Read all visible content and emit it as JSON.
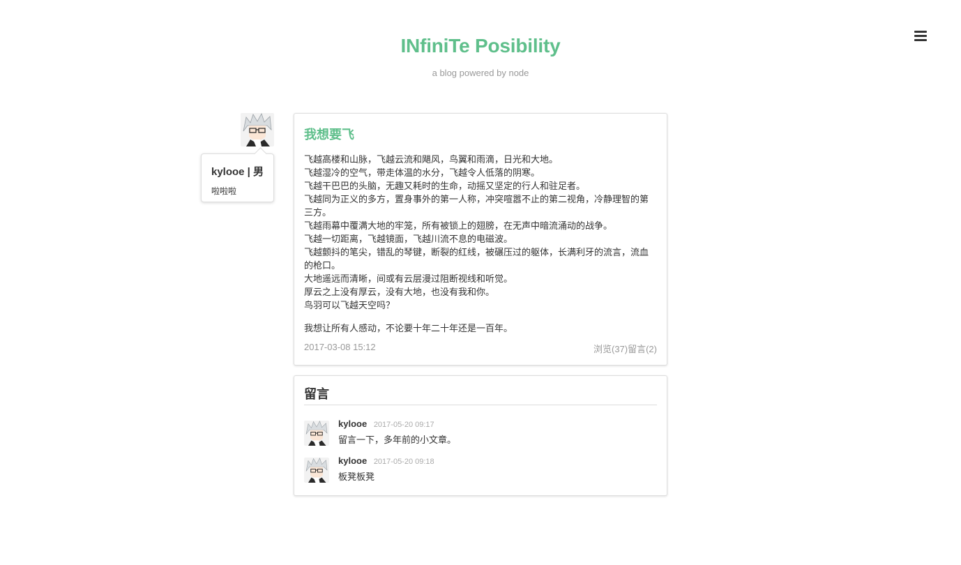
{
  "header": {
    "title": "INfiniTe Posibility",
    "subtitle": "a blog powered by node",
    "menu_icon": "hamburger-menu-icon"
  },
  "author": {
    "name_line": "kylooe | 男",
    "bio": "啦啦啦",
    "avatar": "avatar-image"
  },
  "post": {
    "title": "我想要飞",
    "lines": [
      "飞越高楼和山脉，飞越云流和飓风，鸟翼和雨滴，日光和大地。",
      "飞越湿冷的空气，带走体温的水分，飞越令人低落的阴寒。",
      "飞越干巴巴的头脑，无趣又耗时的生命，动摇又坚定的行人和驻足者。",
      "飞越同为正义的多方，置身事外的第一人称，冲突喧嚣不止的第二视角，冷静理智的第三方。",
      "飞越雨幕中覆满大地的牢笼，所有被锁上的翅膀，在无声中暗流涌动的战争。",
      "飞越一切距离，飞越镜面，飞越川流不息的电磁波。",
      "飞越颤抖的笔尖，错乱的琴键，断裂的红线，被碾压过的躯体，长满利牙的流言，流血的枪口。",
      "大地遥远而清晰，间或有云层漫过阻断视线和听觉。",
      "厚云之上没有厚云，没有大地，也没有我和你。",
      "鸟羽可以飞越天空吗？"
    ],
    "closing": "我想让所有人感动，不论要十年二十年还是一百年。",
    "date": "2017-03-08 15:12",
    "stats": "浏览(37)留言(2)"
  },
  "comments": {
    "title": "留言",
    "items": [
      {
        "author": "kylooe",
        "time": "2017-05-20 09:17",
        "text": "留言一下，多年前的小文章。"
      },
      {
        "author": "kylooe",
        "time": "2017-05-20 09:18",
        "text": "板凳板凳"
      }
    ]
  }
}
